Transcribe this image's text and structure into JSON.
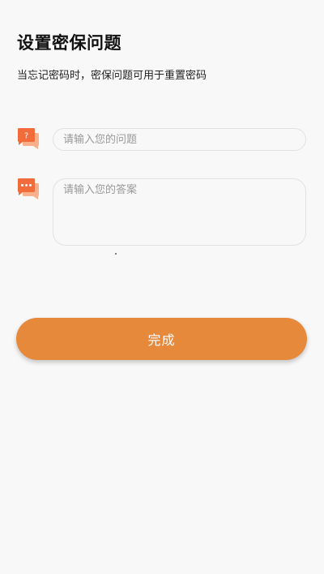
{
  "page": {
    "title": "设置密保问题",
    "subtitle": "当忘记密码时，密保问题可用于重置密码"
  },
  "question": {
    "icon": "question-chat-icon",
    "value": "",
    "placeholder": "请输入您的问题"
  },
  "answer": {
    "icon": "answer-chat-icon",
    "value": "",
    "placeholder": "请输入您的答案"
  },
  "actions": {
    "done_label": "完成"
  },
  "colors": {
    "accent": "#e7893a",
    "icon_primary": "#f26b3a",
    "icon_secondary": "#f9b08a",
    "background": "#f8f8f8",
    "input_border": "#e2e2e2"
  }
}
